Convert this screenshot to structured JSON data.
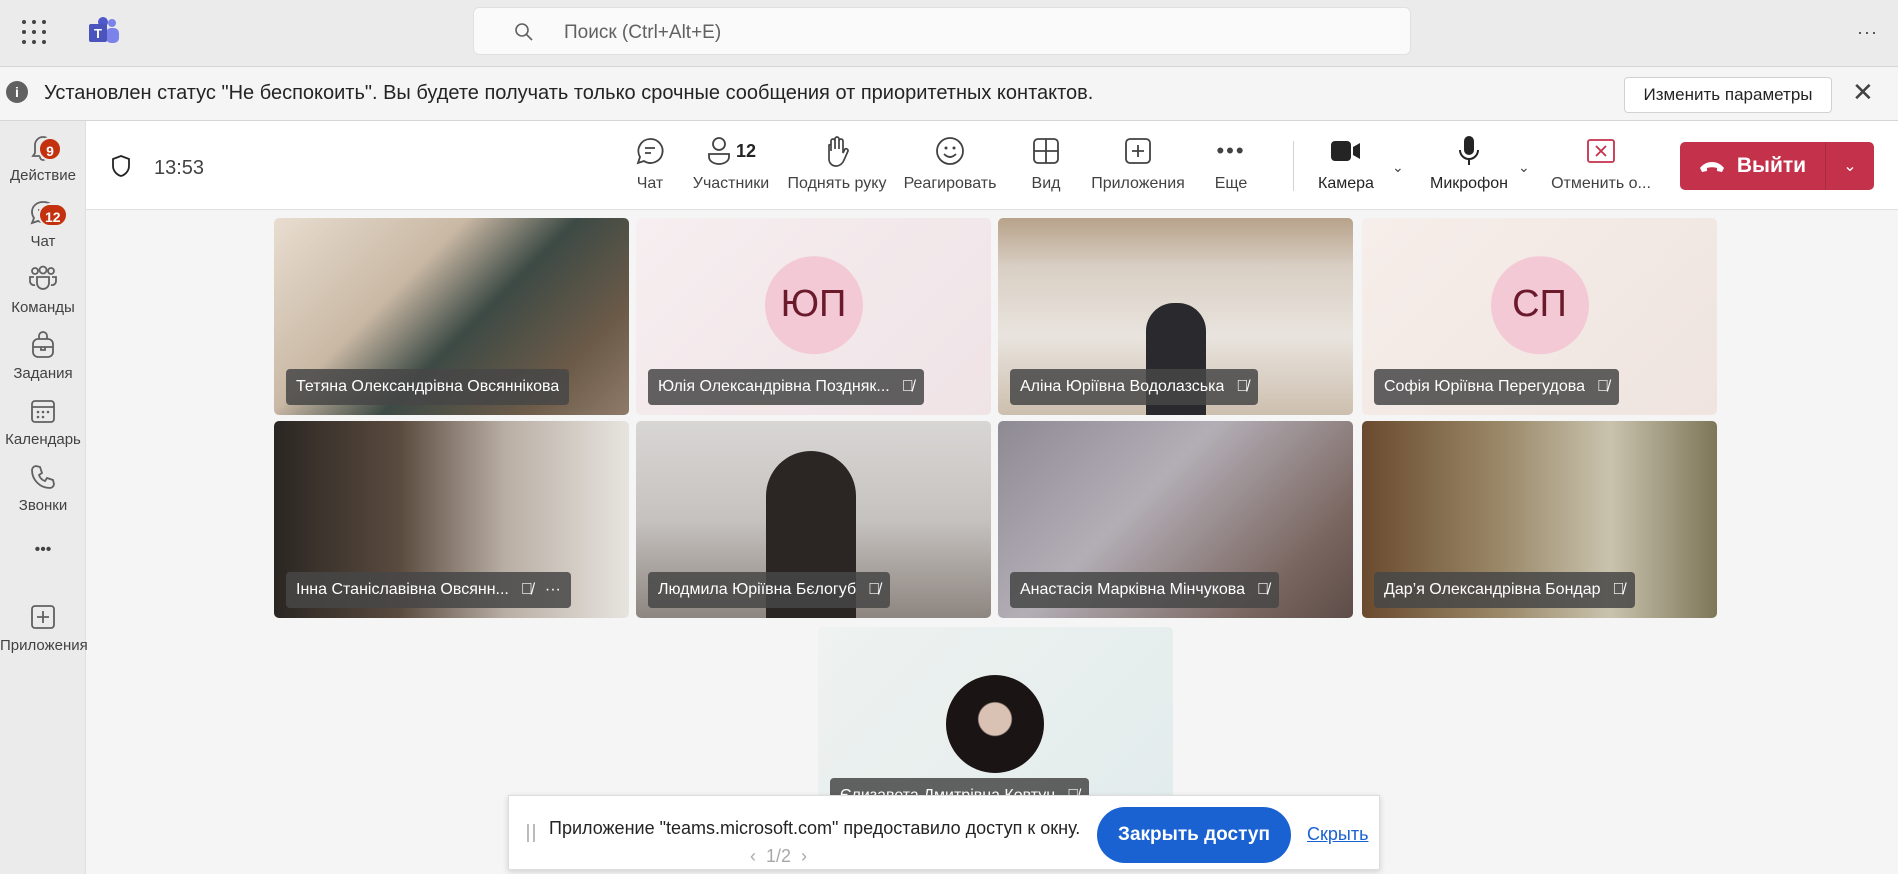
{
  "topbar": {
    "search_placeholder": "Поиск (Ctrl+Alt+E)",
    "more": "···"
  },
  "notice": {
    "message": "Установлен статус \"Не беспокоить\". Вы будете получать только срочные сообщения от приоритетных контактов.",
    "button": "Изменить параметры",
    "info": "i",
    "close": "✕"
  },
  "sidebar": {
    "items": [
      {
        "label": "Действие",
        "badge": "9"
      },
      {
        "label": "Чат",
        "badge": "12"
      },
      {
        "label": "Команды"
      },
      {
        "label": "Задания"
      },
      {
        "label": "Календарь"
      },
      {
        "label": "Звонки"
      },
      {
        "label": "•••"
      },
      {
        "label": "Приложения"
      }
    ]
  },
  "toolbar": {
    "time": "13:53",
    "participants_count": "12",
    "buttons": {
      "chat": "Чат",
      "participants": "Участники",
      "raise_hand": "Поднять руку",
      "react": "Реагировать",
      "view": "Вид",
      "apps": "Приложения",
      "more": "Еще",
      "camera": "Камера",
      "mic": "Микрофон",
      "stop_share": "Отменить о..."
    },
    "leave": "Выйти"
  },
  "participants": [
    {
      "name": "Тетяна Олександрівна Овсяннікова"
    },
    {
      "name": "Юлія Олександрівна Поздняк...",
      "initials": "ЮП"
    },
    {
      "name": "Аліна Юріївна Водолазська"
    },
    {
      "name": "Софія Юріївна Перегудова",
      "initials": "СП"
    },
    {
      "name": "Інна Станіславівна Овсянн..."
    },
    {
      "name": "Людмила Юріївна Бєлогуб"
    },
    {
      "name": "Анастасія Марківна Мінчукова"
    },
    {
      "name": "Дар’я Олександрівна Бондар"
    },
    {
      "name": "Єлизавета Дмитрівна Ковтун"
    }
  ],
  "pager": "1/2",
  "share": {
    "message": "Приложение \"teams.microsoft.com\" предоставило доступ к окну.",
    "close_button": "Закрыть доступ",
    "hide_link": "Скрыть"
  },
  "colors": {
    "leave": "#c4314b",
    "badge": "#c4310e",
    "share_button": "#1a62d2"
  }
}
